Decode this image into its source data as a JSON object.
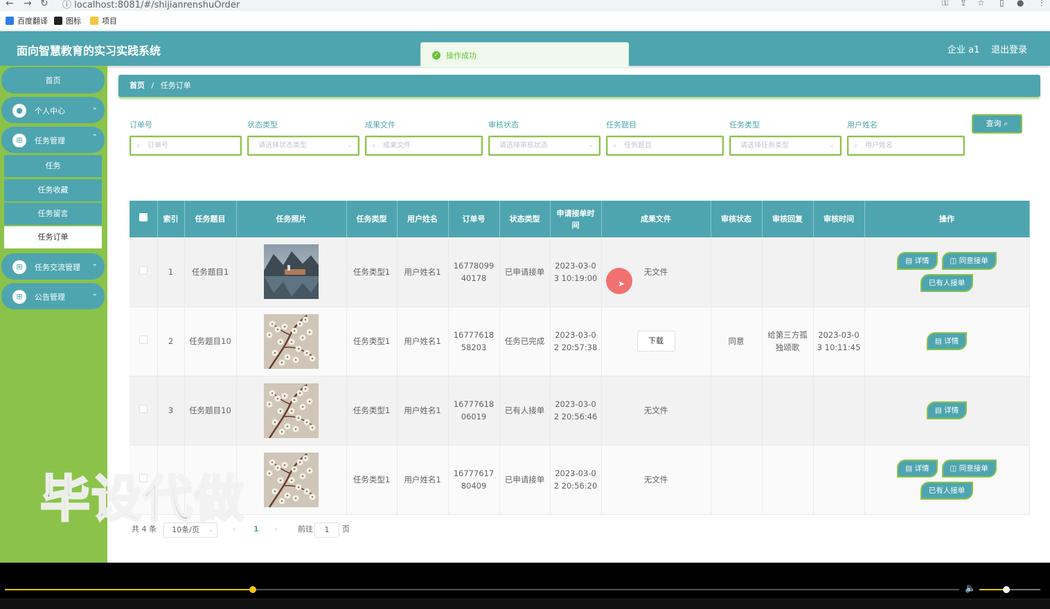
{
  "browser": {
    "url": "localhost:8081/#/shijianrenshuOrder"
  },
  "bookmarks": [
    {
      "label": "百度翻译",
      "color": "#2b7de9"
    },
    {
      "label": "图标",
      "color": "#222222"
    },
    {
      "label": "项目",
      "color": "#f5c542"
    }
  ],
  "header": {
    "title": "面向智慧教育的实习实践系统",
    "user": "企业 a1",
    "logout": "退出登录"
  },
  "toast": {
    "message": "操作成功"
  },
  "sidebar": {
    "home": "首页",
    "personal": "个人中心",
    "task_mgmt": "任务管理",
    "sub_items": [
      "任务",
      "任务收藏",
      "任务留言",
      "任务订单"
    ],
    "exchange": "任务交流管理",
    "notice": "公告管理"
  },
  "breadcrumb": {
    "home": "首页",
    "sep": "/",
    "current": "任务订单"
  },
  "filters": [
    {
      "label": "订单号",
      "placeholder": "订单号",
      "kind": "input"
    },
    {
      "label": "状态类型",
      "placeholder": "请选择状态类型",
      "kind": "select"
    },
    {
      "label": "成果文件",
      "placeholder": "成果文件",
      "kind": "input"
    },
    {
      "label": "审核状态",
      "placeholder": "请选择审核状态",
      "kind": "select"
    },
    {
      "label": "任务题目",
      "placeholder": "任务题目",
      "kind": "input"
    },
    {
      "label": "任务类型",
      "placeholder": "请选择任务类型",
      "kind": "select"
    },
    {
      "label": "用户姓名",
      "placeholder": "用户姓名",
      "kind": "input"
    }
  ],
  "query_button": "查询",
  "table": {
    "headers": [
      "索引",
      "任务题目",
      "任务照片",
      "任务类型",
      "用户姓名",
      "订单号",
      "状态类型",
      "申请接单时间",
      "成果文件",
      "审核状态",
      "审核回复",
      "审核时间",
      "操作"
    ],
    "rows": [
      {
        "index": "1",
        "title": "任务题目1",
        "photo": "lake-village",
        "type": "任务类型1",
        "user": "用户姓名1",
        "order_a": "16778099",
        "order_b": "40178",
        "status": "已申请接单",
        "time_a": "2023-03-0",
        "time_b": "3 10:19:00",
        "file": "无文件",
        "review": "",
        "reply_a": "",
        "reply_b": "",
        "rtime_a": "",
        "rtime_b": "",
        "actions": [
          "详情",
          "同意接单",
          "已有人接单"
        ]
      },
      {
        "index": "2",
        "title": "任务题目10",
        "photo": "blossom",
        "type": "任务类型1",
        "user": "用户姓名1",
        "order_a": "16777618",
        "order_b": "58203",
        "status": "任务已完成",
        "time_a": "2023-03-0",
        "time_b": "2 20:57:38",
        "file": "下载",
        "review": "同意",
        "reply_a": "给第三方孤",
        "reply_b": "独颂歌",
        "rtime_a": "2023-03-0",
        "rtime_b": "3 10:11:45",
        "actions": [
          "详情"
        ]
      },
      {
        "index": "3",
        "title": "任务题目10",
        "photo": "blossom",
        "type": "任务类型1",
        "user": "用户姓名1",
        "order_a": "16777618",
        "order_b": "06019",
        "status": "已有人接单",
        "time_a": "2023-03-0",
        "time_b": "2 20:56:46",
        "file": "无文件",
        "review": "",
        "reply_a": "",
        "reply_b": "",
        "rtime_a": "",
        "rtime_b": "",
        "actions": [
          "详情"
        ]
      },
      {
        "index": "",
        "title": "",
        "photo": "blossom",
        "type": "任务类型1",
        "user": "用户姓名1",
        "order_a": "16777617",
        "order_b": "80409",
        "status": "已申请接单",
        "time_a": "2023-03-0",
        "time_b": "2 20:56:20",
        "file": "无文件",
        "review": "",
        "reply_a": "",
        "reply_b": "",
        "rtime_a": "",
        "rtime_b": "",
        "actions": [
          "详情",
          "同意接单",
          "已有人接单"
        ]
      }
    ]
  },
  "pager": {
    "total": "共 4 条",
    "page_size": "10条/页",
    "current": "1",
    "goto": "前往",
    "goto_value": "1",
    "page_unit": "页"
  },
  "watermark": "毕设代做",
  "player": {
    "progress": 0.26,
    "volume": 0.44
  }
}
